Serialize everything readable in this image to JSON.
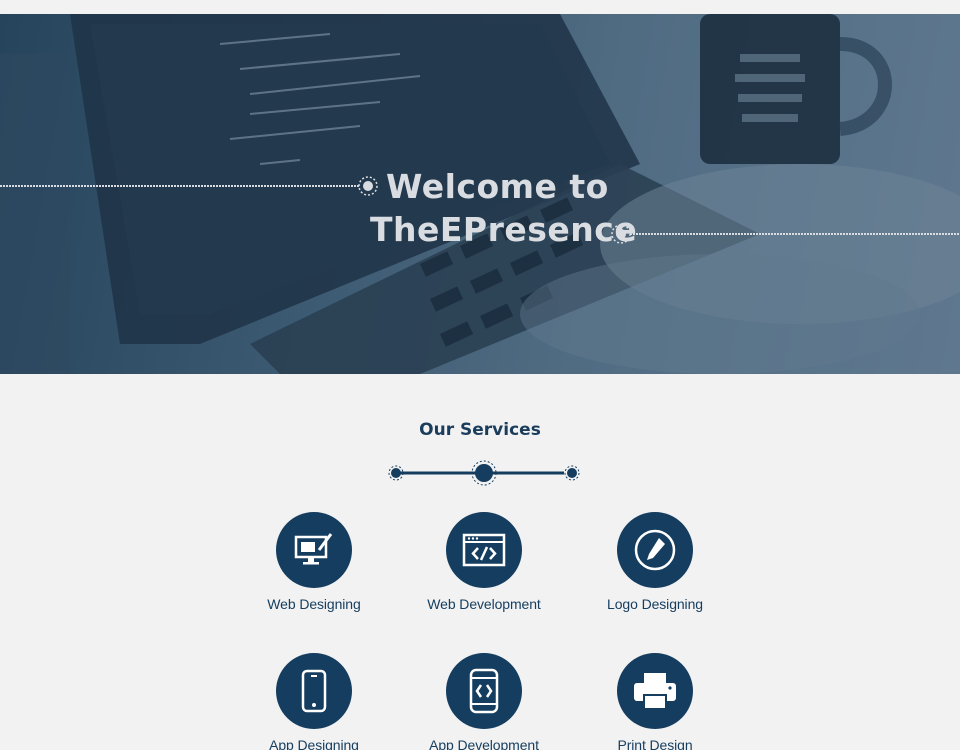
{
  "hero": {
    "line1": "Welcome to",
    "line2": "TheEPresence"
  },
  "services": {
    "title": "Our Services",
    "items": [
      {
        "label": "Web Designing",
        "icon": "monitor-brush-icon"
      },
      {
        "label": "Web Development",
        "icon": "code-window-icon"
      },
      {
        "label": "Logo Designing",
        "icon": "pen-nib-icon"
      },
      {
        "label": "App Designing",
        "icon": "smartphone-icon"
      },
      {
        "label": "App Development",
        "icon": "phone-code-icon"
      },
      {
        "label": "Print Design",
        "icon": "printer-icon"
      }
    ]
  },
  "colors": {
    "accent": "#153d5f",
    "hero_overlay": "#3c5a72",
    "background": "#f2f2f2",
    "hero_text": "#d9dde2"
  }
}
